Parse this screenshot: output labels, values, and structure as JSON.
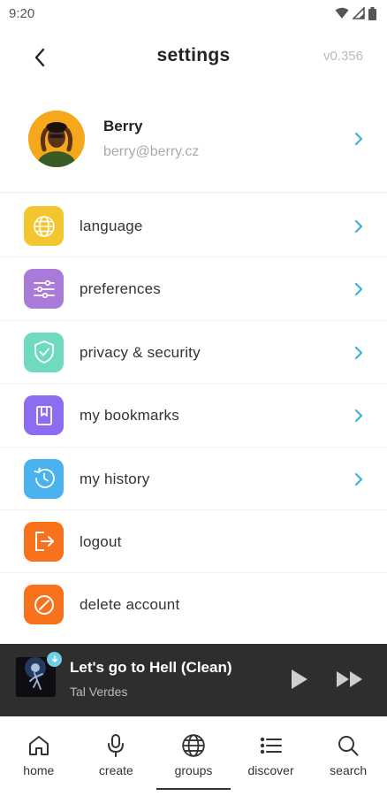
{
  "status": {
    "time": "9:20"
  },
  "header": {
    "title": "settings",
    "version": "v0.356"
  },
  "profile": {
    "name": "Berry",
    "email": "berry@berry.cz"
  },
  "menu": [
    {
      "label": "language",
      "icon": "globe-icon",
      "color": "#f2c62f",
      "has_chevron": true
    },
    {
      "label": "preferences",
      "icon": "sliders-icon",
      "color": "#a77bd7",
      "has_chevron": true
    },
    {
      "label": "privacy & security",
      "icon": "shield-check-icon",
      "color": "#6edac0",
      "has_chevron": true
    },
    {
      "label": "my bookmarks",
      "icon": "bookmark-icon",
      "color": "#8c6cf0",
      "has_chevron": true
    },
    {
      "label": "my history",
      "icon": "history-icon",
      "color": "#4ab2ee",
      "has_chevron": true
    },
    {
      "label": "logout",
      "icon": "logout-icon",
      "color": "#f8711c",
      "has_chevron": false
    },
    {
      "label": "delete account",
      "icon": "ban-icon",
      "color": "#f8711c",
      "has_chevron": false
    }
  ],
  "player": {
    "title": "Let's go to Hell (Clean)",
    "artist": "Tal Verdes"
  },
  "nav": [
    {
      "label": "home",
      "icon": "home-icon",
      "active": false
    },
    {
      "label": "create",
      "icon": "microphone-icon",
      "active": false
    },
    {
      "label": "groups",
      "icon": "globe-icon",
      "active": true
    },
    {
      "label": "discover",
      "icon": "list-icon",
      "active": false
    },
    {
      "label": "search",
      "icon": "search-icon",
      "active": false
    }
  ],
  "colors": {
    "chevron": "#3bb3d6",
    "player_bg": "#2e2e2e"
  }
}
